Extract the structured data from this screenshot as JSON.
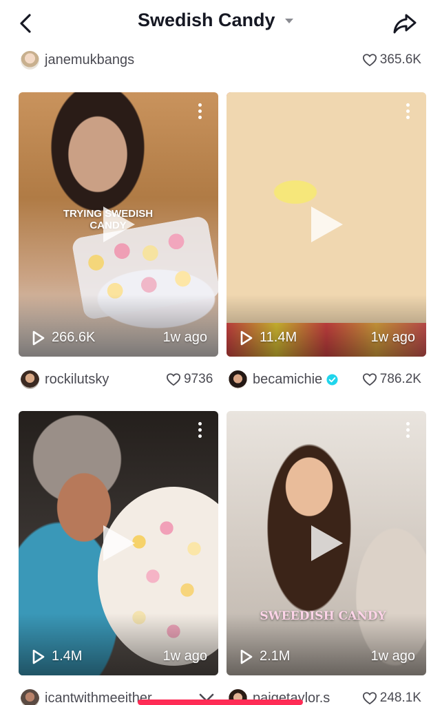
{
  "header": {
    "title": "Swedish Candy",
    "back_icon": "chevron-left-icon",
    "dropdown_icon": "caret-down-icon",
    "share_icon": "share-arrow-icon"
  },
  "top_row": {
    "username": "janemukbangs",
    "likes": "365.6K"
  },
  "videos": [
    {
      "views": "266.6K",
      "age": "1w ago",
      "caption": "TRYING SWEDISH CANDY",
      "author": "rockilutsky",
      "likes": "9736",
      "verified": false
    },
    {
      "views": "11.4M",
      "age": "1w ago",
      "caption": "",
      "author": "becamichie",
      "likes": "786.2K",
      "verified": true
    },
    {
      "views": "1.4M",
      "age": "1w ago",
      "caption": "",
      "author": "icantwithmeeither",
      "likes": "",
      "verified": false
    },
    {
      "views": "2.1M",
      "age": "1w ago",
      "caption": "SWEEDISH CANDY",
      "author": "paigetaylor.s",
      "likes": "248.1K",
      "verified": false
    }
  ],
  "colors": {
    "accent": "#fe2c55",
    "text": "#161823",
    "secondary_text": "#4a4a52",
    "verified": "#20d5ec"
  }
}
